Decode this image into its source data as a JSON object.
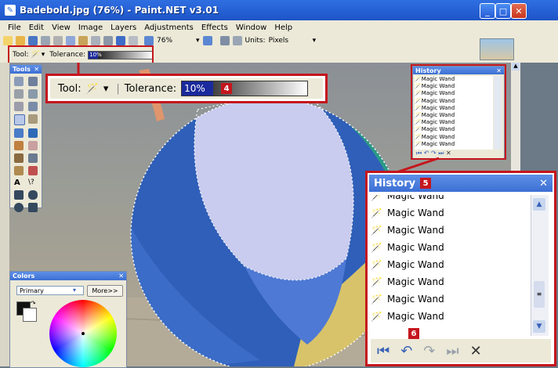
{
  "window": {
    "title": "Badebold.jpg (76%) - Paint.NET v3.01",
    "minimize_label": "_",
    "maximize_label": "□",
    "close_label": "✕"
  },
  "menu": [
    "File",
    "Edit",
    "View",
    "Image",
    "Layers",
    "Adjustments",
    "Effects",
    "Window",
    "Help"
  ],
  "toolbar": {
    "zoom_value": "76%",
    "units_label": "Units:",
    "units_value": "Pixels"
  },
  "tool_options": {
    "tool_label": "Tool:",
    "tolerance_label": "Tolerance:",
    "tolerance_value": "10%",
    "tolerance_fraction": 0.1
  },
  "tools_panel": {
    "title": "Tools",
    "close_label": "✕"
  },
  "history_small": {
    "title": "History",
    "close_label": "✕",
    "items": [
      "Magic Wand",
      "Magic Wand",
      "Magic Wand",
      "Magic Wand",
      "Magic Wand",
      "Magic Wand",
      "Magic Wand",
      "Magic Wand",
      "Magic Wand",
      "Magic Wand"
    ]
  },
  "zoom_callout": {
    "tool_label": "Tool:",
    "tolerance_label": "Tolerance:",
    "tolerance_value": "10%",
    "badge": "4"
  },
  "history_callout": {
    "title": "History",
    "badge": "5",
    "close_label": "✕",
    "items": [
      "Magic Wand",
      "Magic Wand",
      "Magic Wand",
      "Magic Wand",
      "Magic Wand",
      "Magic Wand",
      "Magic Wand",
      "Magic Wand"
    ],
    "badge_controls": "6"
  },
  "colors_panel": {
    "title": "Colors",
    "close_label": "✕",
    "mode_value": "Primary",
    "more_label": "More>>"
  },
  "colors": {
    "accent_red": "#c5161d",
    "title_blue": "#2f6fe2"
  }
}
